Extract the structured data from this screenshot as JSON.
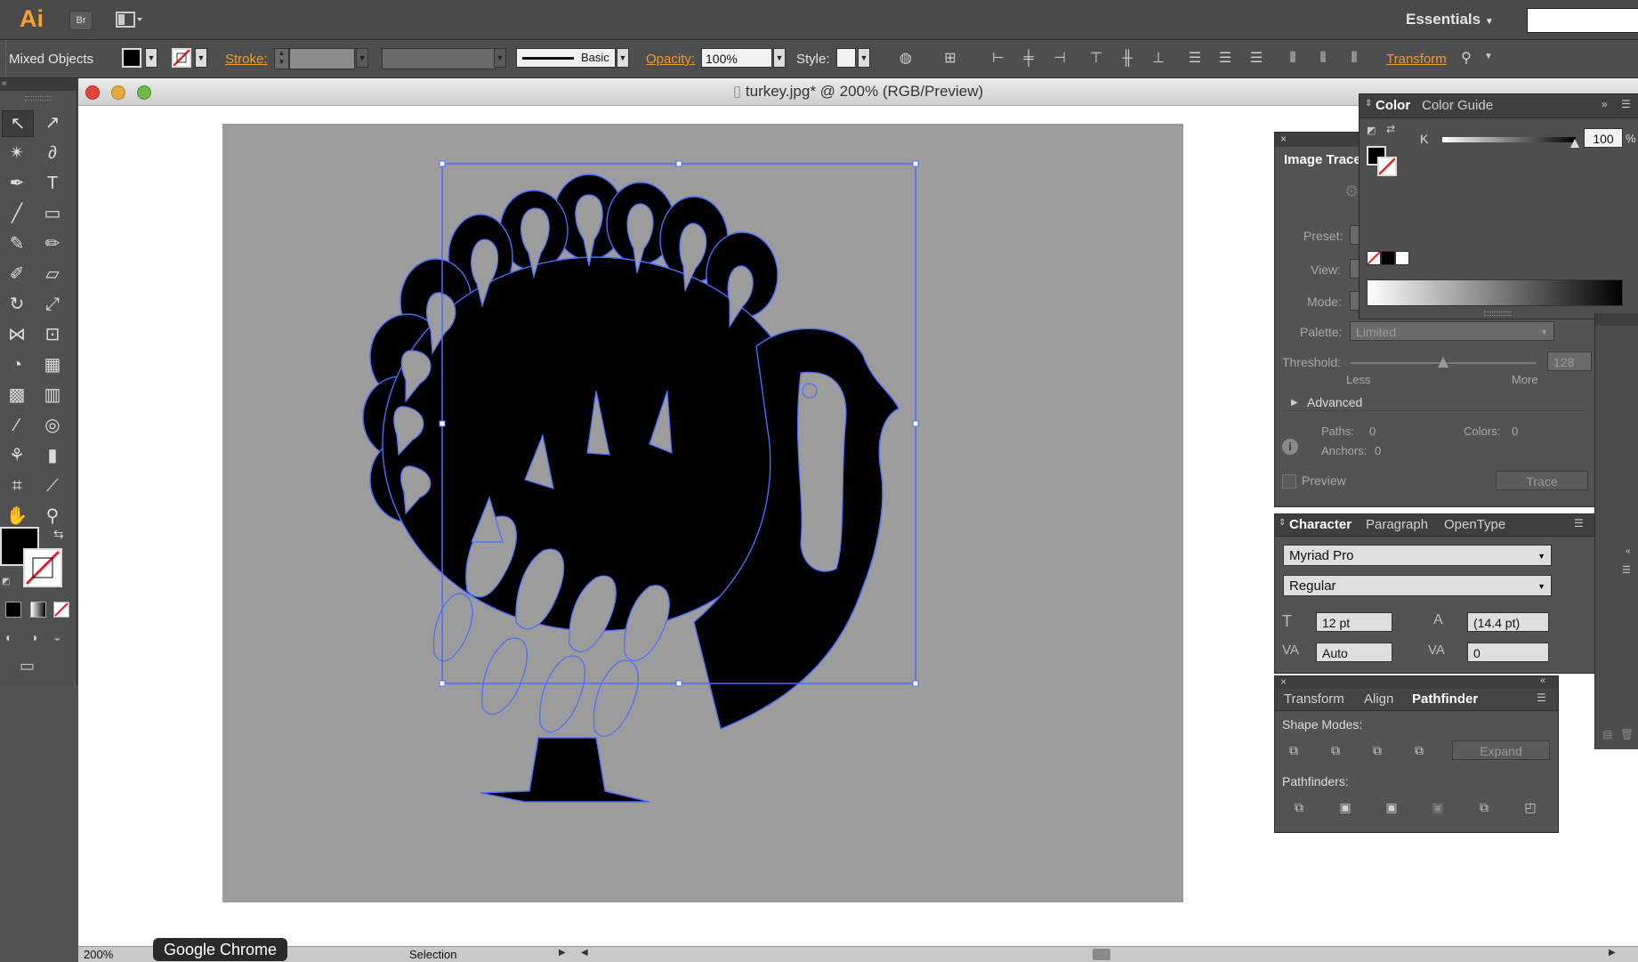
{
  "app": {
    "logo": "Ai",
    "bridge": "Br",
    "workspace": "Essentials"
  },
  "control_bar": {
    "selection": "Mixed Objects",
    "stroke_label": "Stroke:",
    "brush_label": "Basic",
    "opacity_label": "Opacity:",
    "opacity_value": "100%",
    "style_label": "Style:",
    "transform_label": "Transform"
  },
  "document": {
    "title": "turkey.jpg* @ 200% (RGB/Preview)",
    "zoom": "200%",
    "status": "Selection"
  },
  "tooltip": {
    "text": "Google Chrome"
  },
  "color_panel": {
    "tabs": [
      "Color",
      "Color Guide"
    ],
    "channel": "K",
    "value": "100",
    "unit": "%"
  },
  "image_trace_panel": {
    "title": "Image Trace",
    "preset_label": "Preset:",
    "view_label": "View:",
    "mode_label": "Mode:",
    "palette_label": "Palette:",
    "palette_value": "Limited",
    "threshold_label": "Threshold:",
    "threshold_value": "128",
    "threshold_level": 0.5,
    "less": "Less",
    "more": "More",
    "advanced": "Advanced",
    "paths_label": "Paths:",
    "paths_value": "0",
    "colors_label": "Colors:",
    "colors_value": "0",
    "anchors_label": "Anchors:",
    "anchors_value": "0",
    "preview": "Preview",
    "trace": "Trace"
  },
  "character_panel": {
    "tabs": [
      "Character",
      "Paragraph",
      "OpenType"
    ],
    "font": "Myriad Pro",
    "style": "Regular",
    "size": "12 pt",
    "leading": "(14.4 pt)",
    "kerning": "Auto",
    "tracking": "0"
  },
  "pathfinder_panel": {
    "tabs": [
      "Transform",
      "Align",
      "Pathfinder"
    ],
    "shape_modes": "Shape Modes:",
    "expand": "Expand",
    "pathfinders": "Pathfinders:"
  },
  "colors": {
    "accent": "#f29a2e",
    "selection": "#4a6cff",
    "artboard": "#9c9c9c"
  }
}
